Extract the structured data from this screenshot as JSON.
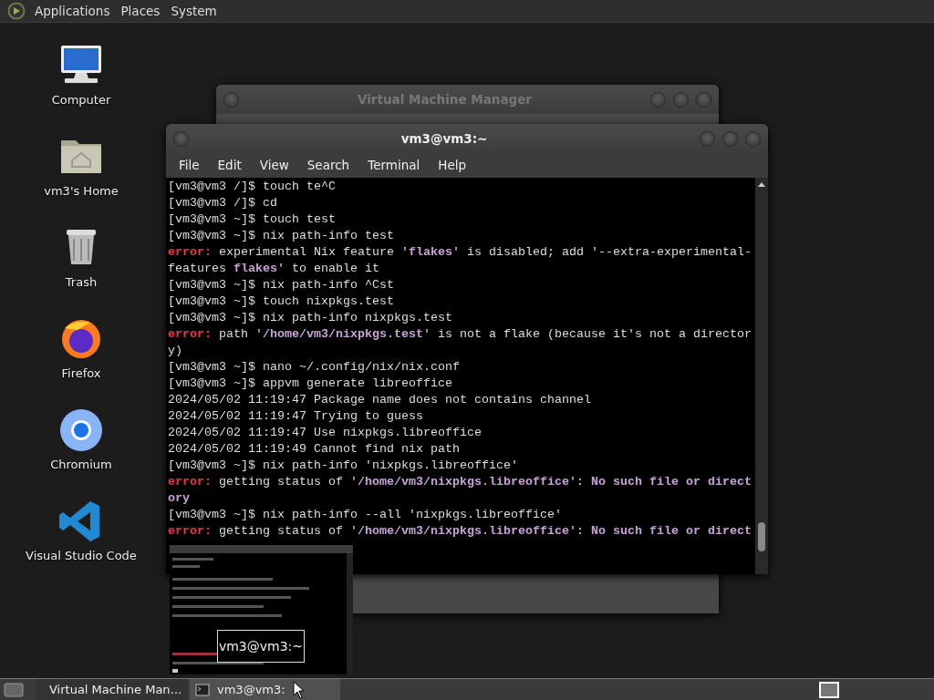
{
  "top_panel": {
    "menus": [
      "Applications",
      "Places",
      "System"
    ]
  },
  "desktop_icons": [
    {
      "kind": "computer",
      "label": "Computer"
    },
    {
      "kind": "home",
      "label": "vm3's Home"
    },
    {
      "kind": "trash",
      "label": "Trash"
    },
    {
      "kind": "firefox",
      "label": "Firefox"
    },
    {
      "kind": "chromium",
      "label": "Chromium"
    },
    {
      "kind": "vscode",
      "label": "Visual Studio Code"
    }
  ],
  "vmm_window": {
    "title": "Virtual Machine Manager"
  },
  "terminal_window": {
    "title": "vm3@vm3:~",
    "menu": [
      "File",
      "Edit",
      "View",
      "Search",
      "Terminal",
      "Help"
    ],
    "lines": [
      {
        "kind": "prompt",
        "text": "[vm3@vm3 /]$ touch te^C"
      },
      {
        "kind": "prompt",
        "text": "[vm3@vm3 /]$ cd"
      },
      {
        "kind": "prompt",
        "text": "[vm3@vm3 ~]$ touch test"
      },
      {
        "kind": "prompt",
        "text": "[vm3@vm3 ~]$ nix path-info test"
      },
      {
        "kind": "error",
        "tag": "error:",
        "text": "experimental Nix feature '**flakes**' is disabled; add '--extra-experimental-"
      },
      {
        "kind": "output",
        "text": "features **flakes**' to enable it"
      },
      {
        "kind": "prompt",
        "text": "[vm3@vm3 ~]$ nix path-info ^Cst"
      },
      {
        "kind": "prompt",
        "text": "[vm3@vm3 ~]$ touch nixpkgs.test"
      },
      {
        "kind": "prompt",
        "text": "[vm3@vm3 ~]$ nix path-info nixpkgs.test"
      },
      {
        "kind": "error",
        "tag": "error:",
        "text": "path '**/home/vm3/nixpkgs.test**' is not a flake (because it's not a director"
      },
      {
        "kind": "output",
        "text": "y)"
      },
      {
        "kind": "prompt",
        "text": "[vm3@vm3 ~]$ nano ~/.config/nix/nix.conf"
      },
      {
        "kind": "prompt",
        "text": "[vm3@vm3 ~]$ appvm generate libreoffice"
      },
      {
        "kind": "output",
        "text": "2024/05/02 11:19:47 Package name does not contains channel"
      },
      {
        "kind": "output",
        "text": "2024/05/02 11:19:47 Trying to guess"
      },
      {
        "kind": "output",
        "text": "2024/05/02 11:19:47 Use nixpkgs.libreoffice"
      },
      {
        "kind": "output",
        "text": "2024/05/02 11:19:49 Cannot find nix path"
      },
      {
        "kind": "prompt",
        "text": "[vm3@vm3 ~]$ nix path-info 'nixpkgs.libreoffice'"
      },
      {
        "kind": "error",
        "tag": "error:",
        "text": "getting status of '**/home/vm3/nixpkgs.libreoffice**': **No such file or direct**"
      },
      {
        "kind": "output",
        "text": "**ory**"
      },
      {
        "kind": "prompt",
        "text": "[vm3@vm3 ~]$ nix path-info --all 'nixpkgs.libreoffice'"
      },
      {
        "kind": "error",
        "tag": "error:",
        "text": "getting status of '**/home/vm3/nixpkgs.libreoffice**': **No such file or direct**"
      }
    ]
  },
  "tooltip": {
    "text": "vm3@vm3:~"
  },
  "taskbar": {
    "items": [
      {
        "label": "Virtual Machine Man…",
        "selected": false
      },
      {
        "label": "vm3@vm3:",
        "selected": true
      }
    ]
  }
}
